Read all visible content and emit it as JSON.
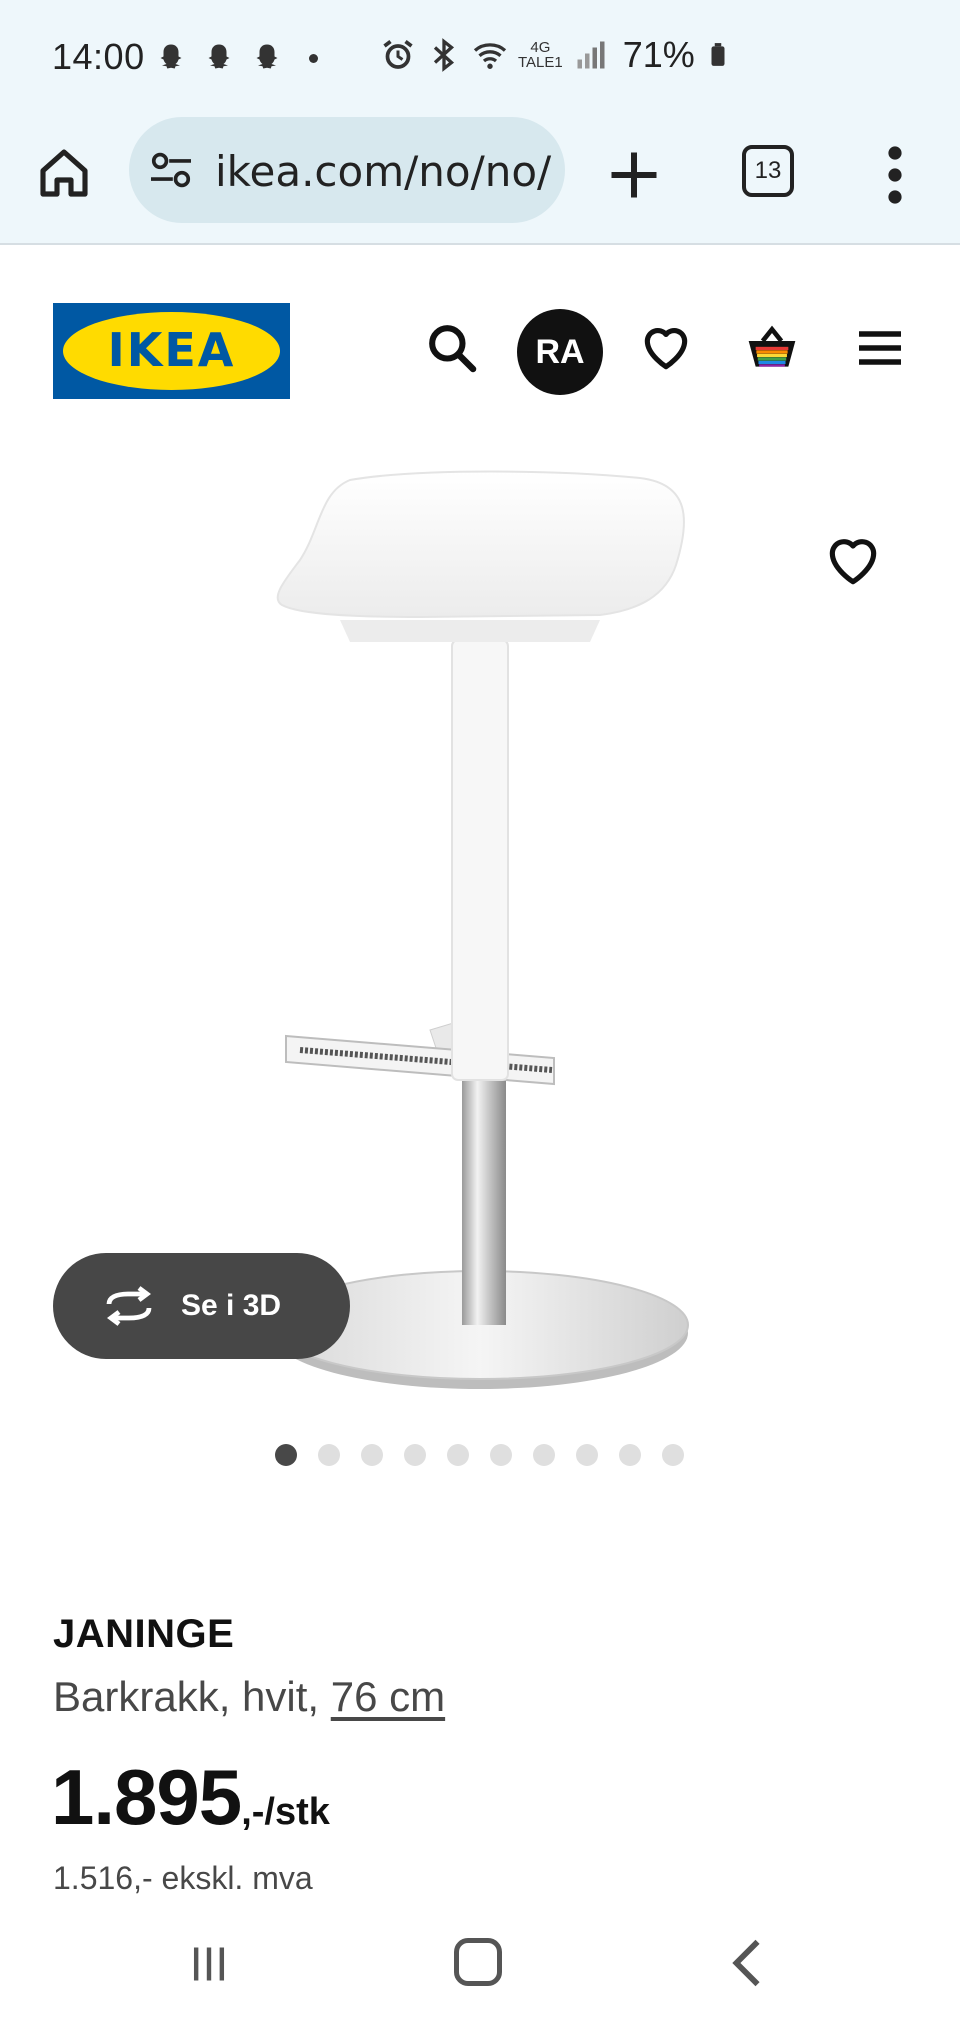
{
  "status_bar": {
    "time": "14:00",
    "network_top": "4G",
    "network_bottom": "TALE1",
    "battery": "71%"
  },
  "browser": {
    "url": "ikea.com/no/no/p",
    "tab_count": "13",
    "icons": [
      "home-icon",
      "site-settings-icon",
      "plus-icon",
      "tab-switcher-icon",
      "more-vert-icon"
    ]
  },
  "header": {
    "logo_text": "IKEA",
    "avatar_initials": "RA",
    "icons": [
      "search-icon",
      "heart-icon",
      "shopping-bag-icon",
      "hamburger-menu-icon"
    ],
    "colors": {
      "logo_blue": "#0058a3",
      "logo_yellow": "#ffdb00"
    }
  },
  "gallery": {
    "view_3d_label": "Se i 3D",
    "dot_count": 10,
    "active_index": 0
  },
  "product": {
    "name": "JANINGE",
    "description": "Barkrakk, hvit, ",
    "size": "76 cm",
    "price": "1.895",
    "price_suffix": ",-/stk",
    "price_ex_vat": "1.516,- ekskl. mva"
  }
}
